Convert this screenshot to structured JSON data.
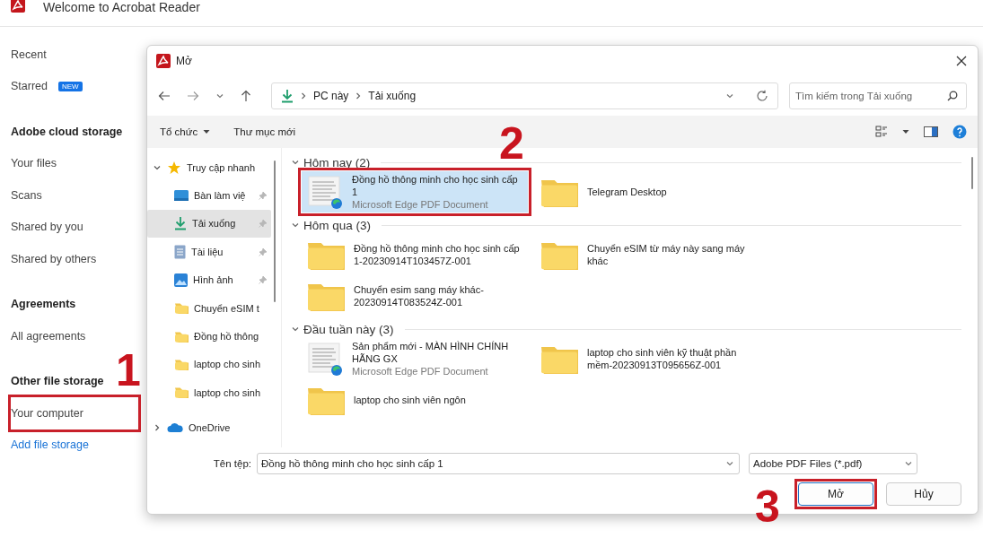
{
  "app": {
    "title": "Welcome to Acrobat Reader"
  },
  "sidebar": {
    "items": [
      {
        "kind": "item",
        "label": "Recent"
      },
      {
        "kind": "item",
        "label": "Starred",
        "badge": "NEW"
      },
      {
        "kind": "header",
        "label": "Adobe cloud storage"
      },
      {
        "kind": "item",
        "label": "Your files"
      },
      {
        "kind": "item",
        "label": "Scans"
      },
      {
        "kind": "item",
        "label": "Shared by you"
      },
      {
        "kind": "item",
        "label": "Shared by others"
      },
      {
        "kind": "header",
        "label": "Agreements"
      },
      {
        "kind": "item",
        "label": "All agreements"
      },
      {
        "kind": "header",
        "label": "Other file storage"
      },
      {
        "kind": "item",
        "label": "Your computer"
      },
      {
        "kind": "link",
        "label": "Add file storage"
      }
    ]
  },
  "dialog": {
    "title": "Mở",
    "breadcrumb": [
      "PC này",
      "Tải xuống"
    ],
    "search": {
      "placeholder": "Tìm kiếm trong Tải xuống"
    },
    "toolbar": {
      "organize": "Tổ chức",
      "new_folder": "Thư mục mới"
    },
    "nav": [
      {
        "kind": "star",
        "label": "Truy cập nhanh",
        "expanded": true,
        "selected": false,
        "children": [
          {
            "kind": "desktop",
            "label": "Bàn làm việ",
            "pinned": true,
            "selected": false
          },
          {
            "kind": "download",
            "label": "Tải xuống",
            "pinned": true,
            "selected": true
          },
          {
            "kind": "document",
            "label": "Tài liệu",
            "pinned": true,
            "selected": false
          },
          {
            "kind": "picture",
            "label": "Hình ảnh",
            "pinned": true,
            "selected": false
          },
          {
            "kind": "folder",
            "label": "Chuyển eSIM t",
            "pinned": false,
            "selected": false
          },
          {
            "kind": "folder",
            "label": "Đồng hồ thông",
            "pinned": false,
            "selected": false
          },
          {
            "kind": "folder",
            "label": "laptop cho sinh",
            "pinned": false,
            "selected": false
          },
          {
            "kind": "folder",
            "label": "laptop cho sinh",
            "pinned": false,
            "selected": false
          }
        ]
      },
      {
        "kind": "cloud",
        "label": "OneDrive",
        "expanded": false,
        "selected": false
      }
    ],
    "groups": [
      {
        "title": "Hôm nay (2)",
        "expanded": true,
        "items": [
          {
            "kind": "pdf",
            "name": "Đồng hồ thông minh cho học sinh cấp 1",
            "type": "Microsoft Edge PDF Document",
            "selected": true
          },
          {
            "kind": "folder",
            "name": "Telegram Desktop",
            "selected": false
          }
        ]
      },
      {
        "title": "Hôm qua (3)",
        "expanded": true,
        "items": [
          {
            "kind": "folder",
            "name": "Đồng hồ thông minh cho học sinh cấp 1-20230914T103457Z-001",
            "selected": false
          },
          {
            "kind": "folder",
            "name": "Chuyển eSIM từ máy này sang máy khác",
            "selected": false
          },
          {
            "kind": "folder",
            "name": "Chuyển esim sang máy khác-20230914T083524Z-001",
            "selected": false
          }
        ]
      },
      {
        "title": "Đầu tuần này (3)",
        "expanded": true,
        "items": [
          {
            "kind": "pdf",
            "name": "Sản phẩm mới - MÀN HÌNH CHÍNH HÃNG GX",
            "type": "Microsoft Edge PDF Document",
            "selected": false
          },
          {
            "kind": "folder",
            "name": "laptop cho sinh viên kỹ thuật phần mềm-20230913T095656Z-001",
            "selected": false
          },
          {
            "kind": "folder",
            "name": "laptop cho sinh viên ngôn",
            "selected": false
          }
        ]
      }
    ],
    "filename_label": "Tên tệp:",
    "filename": "Đồng hồ thông minh cho học sinh cấp 1",
    "file_type": "Adobe PDF Files (*.pdf)",
    "buttons": [
      {
        "label": "Mở",
        "primary": true
      },
      {
        "label": "Hủy",
        "primary": false
      }
    ]
  },
  "annotations": [
    {
      "label": "1"
    },
    {
      "label": "2"
    },
    {
      "label": "3"
    }
  ]
}
